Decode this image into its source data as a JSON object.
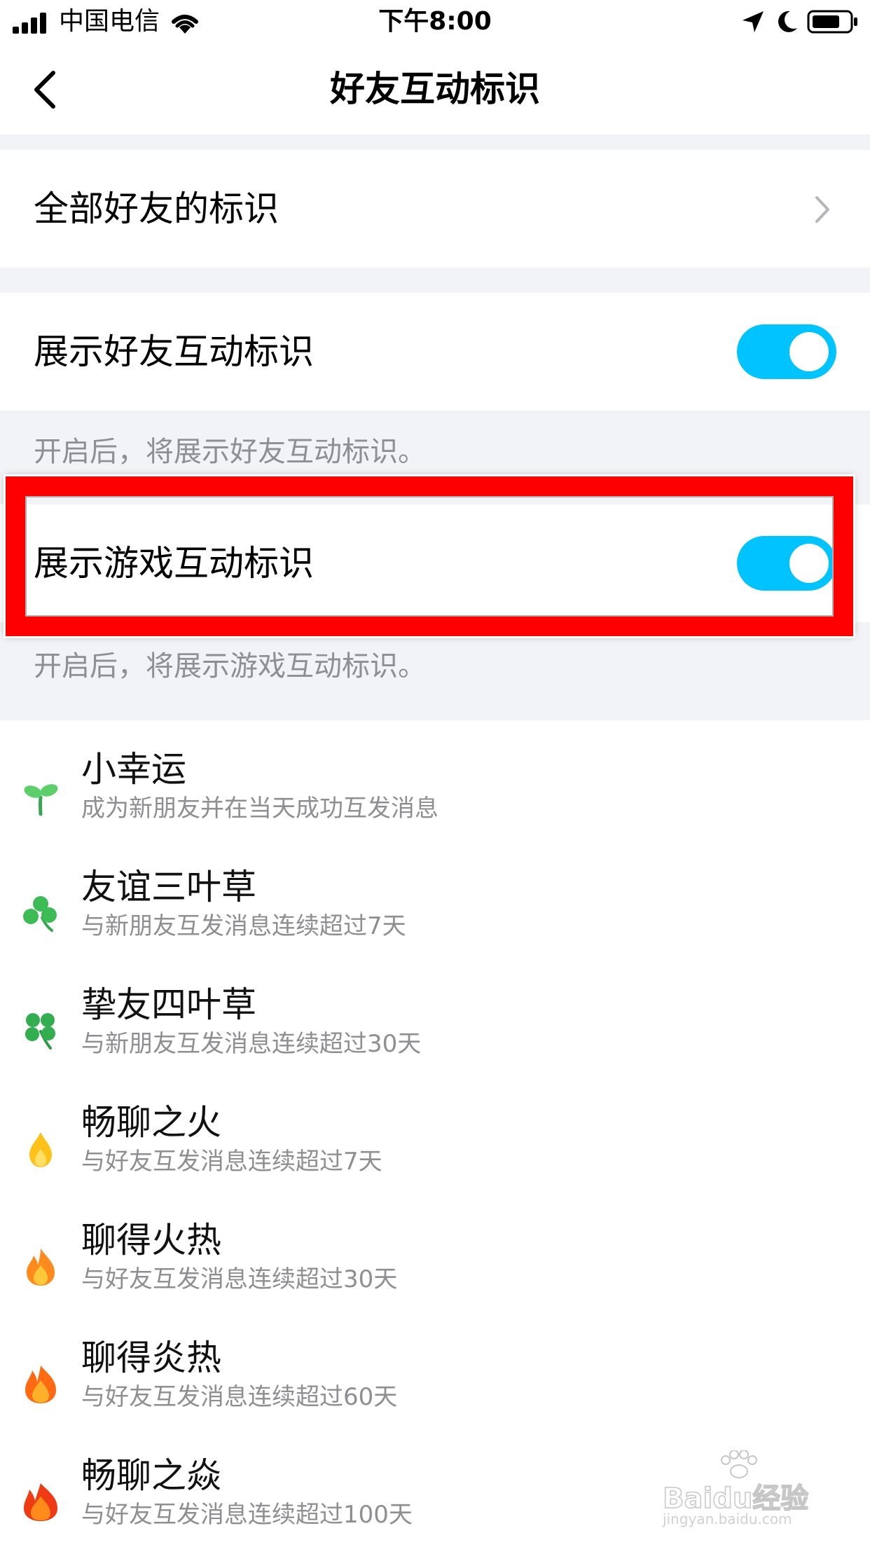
{
  "status_bar": {
    "carrier": "中国电信",
    "time": "下午8:00"
  },
  "nav": {
    "title": "好友互动标识"
  },
  "all_friends": {
    "label": "全部好友的标识"
  },
  "toggles": [
    {
      "label": "展示好友互动标识",
      "hint": "开启后，将展示好友互动标识。",
      "on": true
    },
    {
      "label": "展示游戏互动标识",
      "hint": "开启后，将展示游戏互动标识。",
      "on": true
    }
  ],
  "colors": {
    "toggle_on": "#00c3ff",
    "highlight_border": "#ff0000",
    "background": "#f2f3f7"
  },
  "badges": [
    {
      "icon": "sprout-icon",
      "title": "小幸运",
      "desc": "成为新朋友并在当天成功互发消息"
    },
    {
      "icon": "three-leaf-clover-icon",
      "title": "友谊三叶草",
      "desc": "与新朋友互发消息连续超过7天"
    },
    {
      "icon": "four-leaf-clover-icon",
      "title": "挚友四叶草",
      "desc": "与新朋友互发消息连续超过30天"
    },
    {
      "icon": "small-flame-icon",
      "title": "畅聊之火",
      "desc": "与好友互发消息连续超过7天"
    },
    {
      "icon": "flame-icon",
      "title": "聊得火热",
      "desc": "与好友互发消息连续超过30天"
    },
    {
      "icon": "big-flame-icon",
      "title": "聊得炎热",
      "desc": "与好友互发消息连续超过60天"
    },
    {
      "icon": "blaze-icon",
      "title": "畅聊之焱",
      "desc": "与好友互发消息连续超过100天"
    }
  ],
  "watermark": {
    "brand": "Baidu经验",
    "url": "jingyan.baidu.com"
  }
}
